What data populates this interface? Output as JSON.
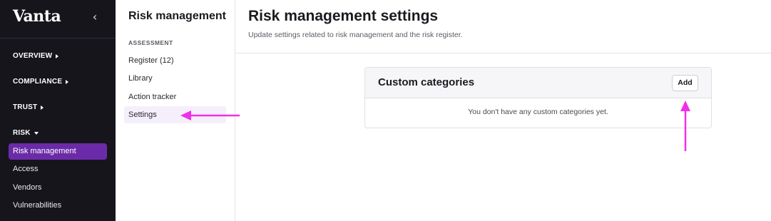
{
  "sidebar": {
    "logo": "Vanta",
    "collapse_icon": "‹",
    "sections": [
      {
        "label": "OVERVIEW",
        "icon": "caret-right"
      },
      {
        "label": "COMPLIANCE",
        "icon": "caret-right"
      },
      {
        "label": "TRUST",
        "icon": "caret-right"
      },
      {
        "label": "RISK",
        "icon": "caret-down"
      }
    ],
    "items": [
      {
        "label": "Risk management",
        "active": true
      },
      {
        "label": "Access"
      },
      {
        "label": "Vendors"
      },
      {
        "label": "Vulnerabilities"
      }
    ]
  },
  "submenu": {
    "title": "Risk management",
    "group_label": "ASSESSMENT",
    "items": [
      {
        "label": "Register (12)"
      },
      {
        "label": "Library"
      },
      {
        "label": "Action tracker"
      },
      {
        "label": "Settings",
        "active": true
      }
    ]
  },
  "main": {
    "title": "Risk management settings",
    "subtitle": "Update settings related to risk management and the risk register.",
    "card": {
      "title": "Custom categories",
      "add_label": "Add",
      "empty_text": "You don't have any custom categories yet."
    }
  },
  "colors": {
    "sidebar_bg": "#17151c",
    "active_nav": "#6b2ba8",
    "annotation_arrow": "#f030e8"
  }
}
